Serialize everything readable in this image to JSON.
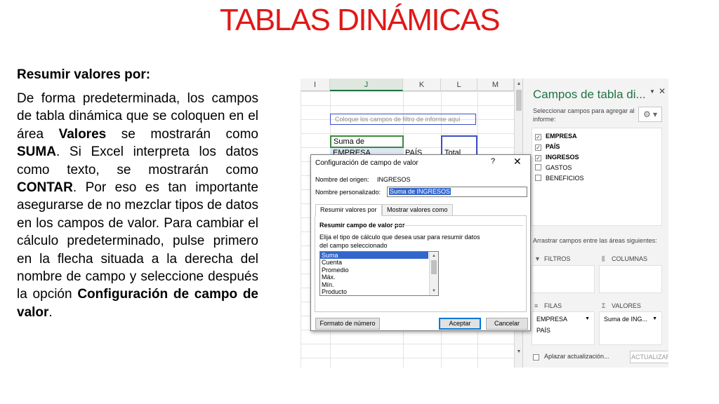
{
  "slide": {
    "title": "TABLAS DINÁMICAS",
    "heading": "Resumir valores por:",
    "para": [
      {
        "text": "De forma predeterminada, los campos de tabla dinámica que se coloquen en el área ",
        "bold": false
      },
      {
        "text": "Valores",
        "bold": true
      },
      {
        "text": " se mostrarán como ",
        "bold": false
      },
      {
        "text": "SUMA",
        "bold": true
      },
      {
        "text": ". Si Excel interpreta los datos como texto, se mostrarán como ",
        "bold": false
      },
      {
        "text": "CONTAR",
        "bold": true
      },
      {
        "text": ". Por eso es tan importante asegurarse de no mezclar tipos de datos en los campos de valor. Para cambiar el cálculo predeterminado, pulse primero en la flecha situada a la derecha del nombre de campo y seleccione después la opción ",
        "bold": false
      },
      {
        "text": "Configuración de campo de valor",
        "bold": true
      },
      {
        "text": ".",
        "bold": false
      }
    ]
  },
  "sheet": {
    "columns": [
      "I",
      "J",
      "K",
      "L",
      "M"
    ],
    "filter_placeholder": "Coloque los campos de filtro de informe aquí",
    "suma_cell": "Suma de INGRESOS",
    "row_empresa": "EMPRESA",
    "row_pais": "PAÍS",
    "row_total": "Total"
  },
  "dialog": {
    "title": "Configuración de campo de valor",
    "help": "?",
    "close": "✕",
    "source_label": "Nombre del origen:",
    "source_value": "INGRESOS",
    "custom_label": "Nombre personalizado:",
    "custom_value": "Suma de INGRESOS",
    "tabs": [
      "Resumir valores por",
      "Mostrar valores como"
    ],
    "section_title": "Resumir campo de valor por",
    "instruction": "Elija el tipo de cálculo que desea usar para resumir datos del campo seleccionado",
    "functions": [
      "Suma",
      "Cuenta",
      "Promedio",
      "Máx.",
      "Mín.",
      "Producto"
    ],
    "selected_function": "Suma",
    "format_button": "Formato de número",
    "ok_button": "Aceptar",
    "cancel_button": "Cancelar"
  },
  "pane": {
    "title": "Campos de tabla di...",
    "dropdown_glyph": "▼",
    "close": "✕",
    "subtitle": "Seleccionar campos para agregar al informe:",
    "gear": "⚙ ▾",
    "fields": [
      {
        "name": "EMPRESA",
        "checked": true
      },
      {
        "name": "PAÍS",
        "checked": true
      },
      {
        "name": "INGRESOS",
        "checked": true
      },
      {
        "name": "GASTOS",
        "checked": false
      },
      {
        "name": "BENEFICIOS",
        "checked": false
      }
    ],
    "areas_label": "Arrastrar campos entre las áreas siguientes:",
    "filters_label": "FILTROS",
    "columns_label": "COLUMNAS",
    "rows_label": "FILAS",
    "values_label": "VALORES",
    "rows_items": [
      "EMPRESA",
      "PAÍS"
    ],
    "values_items": [
      "Suma de ING..."
    ],
    "defer_label": "Aplazar actualización...",
    "update_button": "ACTUALIZAR"
  }
}
